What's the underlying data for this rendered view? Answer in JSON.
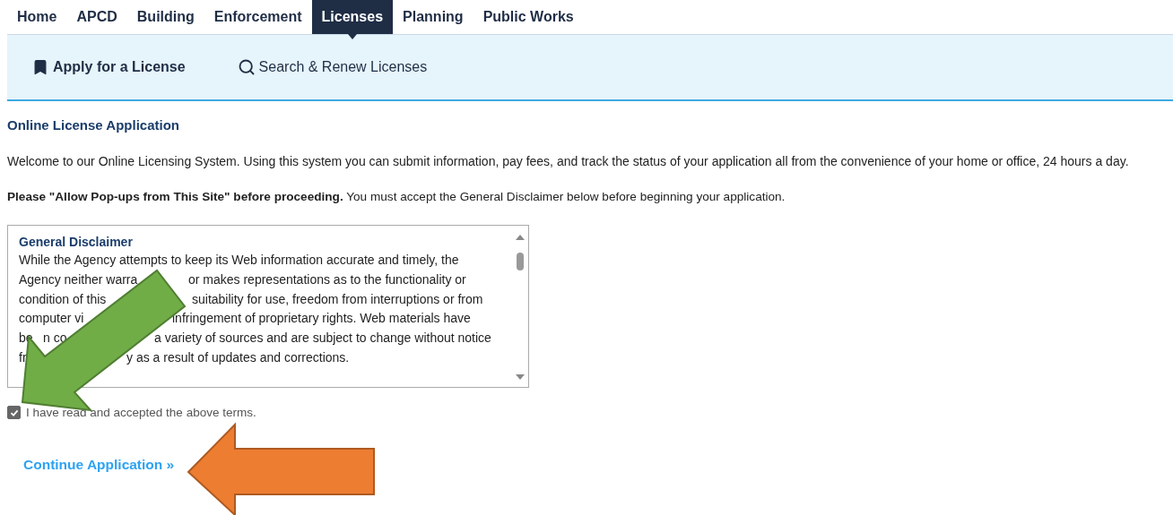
{
  "nav": {
    "tabs": [
      {
        "label": "Home",
        "selected": false
      },
      {
        "label": "APCD",
        "selected": false
      },
      {
        "label": "Building",
        "selected": false
      },
      {
        "label": "Enforcement",
        "selected": false
      },
      {
        "label": "Licenses",
        "selected": true
      },
      {
        "label": "Planning",
        "selected": false
      },
      {
        "label": "Public Works",
        "selected": false
      }
    ]
  },
  "subnav": {
    "items": [
      {
        "label": "Apply for a License",
        "selected": true
      },
      {
        "label": "Search & Renew Licenses",
        "selected": false
      }
    ]
  },
  "heading": "Online License Application",
  "intro": "Welcome to our Online Licensing System. Using this system you can submit information, pay fees, and track the status of your application all from the convenience of your home or office, 24 hours a day.",
  "notice": "**Please \"Allow Pop-ups from This Site\" before proceeding.** You must accept the General Disclaimer below before beginning your application.",
  "disclaimer": {
    "title": "General Disclaimer",
    "lines": [
      [
        "While the Agency attempts to keep its Web information accurate and timely, the"
      ],
      [
        "Agency neither warra",
        "or makes representations as to the functionality or"
      ],
      [
        "condition of this",
        "suitability for use, freedom from interruptions or from"
      ],
      [
        "computer vi",
        "infringement of proprietary rights. Web materials have"
      ],
      [
        "be",
        "n co",
        "a variety of sources and are subject to change without notice"
      ],
      [
        "fr",
        "y as a result of updates and corrections."
      ]
    ]
  },
  "accept": {
    "label": "I have read and accepted the above terms.",
    "checked": true
  },
  "continue_link": "Continue Application »",
  "annotations": [
    {
      "color": "#70ad47"
    },
    {
      "color": "#ed7d31"
    }
  ]
}
